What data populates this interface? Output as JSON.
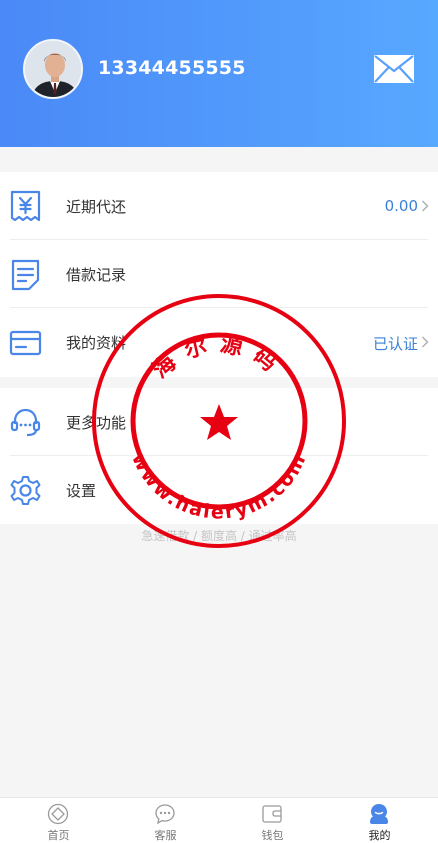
{
  "header": {
    "phone": "13344455555"
  },
  "menu_primary": [
    {
      "label": "近期代还",
      "value": "0.00"
    },
    {
      "label": "借款记录",
      "value": ""
    },
    {
      "label": "我的资料",
      "value": "已认证"
    }
  ],
  "menu_secondary": [
    {
      "label": "更多功能"
    },
    {
      "label": "设置"
    }
  ],
  "footer_note": "急速借款 / 额度高 / 通过率高",
  "watermark": {
    "top_text": "海尔源码",
    "bottom_text": "www.haierym.com"
  },
  "tabbar": [
    {
      "label": "首页",
      "icon": "home-icon"
    },
    {
      "label": "客服",
      "icon": "chat-icon"
    },
    {
      "label": "钱包",
      "icon": "wallet-icon"
    },
    {
      "label": "我的",
      "icon": "user-icon"
    }
  ],
  "colors": {
    "header_start": "#4a89f7",
    "header_end": "#57a8ff",
    "icon_blue": "#4a86e8",
    "value_blue": "#3a80d8",
    "stamp_red": "#e60012"
  }
}
